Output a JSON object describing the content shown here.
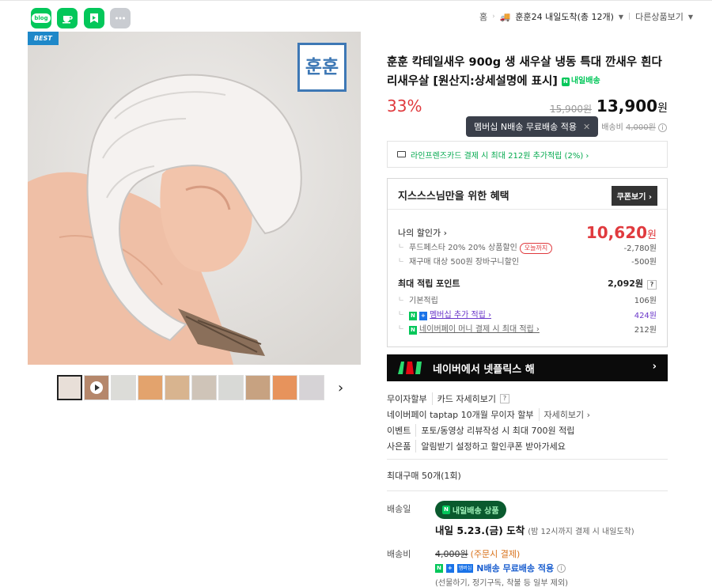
{
  "share": {
    "blog_label": "blog",
    "icons": [
      "blog-icon",
      "cafe-icon",
      "bookmark-icon",
      "more-icon"
    ]
  },
  "breadcrumb": {
    "home": "홈",
    "category": "훈훈24 내일도착(총 12개)",
    "other": "다른상품보기"
  },
  "gallery": {
    "badge": "BEST",
    "brand_logo": "훈훈",
    "thumb_count": 10
  },
  "product": {
    "title": "훈훈 칵테일새우 900g 생 새우살 냉동 특대 깐새우 흰다리새우살 [원산지:상세설명에 표시]",
    "next_day_label": "내일배송",
    "discount_rate": "33%",
    "original_price": "15,900원",
    "sale_price_num": "13,900",
    "sale_price_unit": "원"
  },
  "tooltip": {
    "text": "멤버십 N배송 무료배송 적용",
    "close": "✕"
  },
  "shipping_fee": {
    "label": "배송비",
    "amount": "4,000원"
  },
  "card_promo": {
    "text": "라인프렌즈카드 결제 시 최대 212원 추가적립 (2%) ›"
  },
  "benefit": {
    "title": "지스스스님만을 위한 혜택",
    "coupon_button": "쿠폰보기 ›",
    "my_price_label": "나의 할인가 ›",
    "my_price_num": "10,620",
    "my_price_unit": "원",
    "discounts": [
      {
        "label": "푸드페스타 20% 20% 상품할인",
        "tag": "오늘까지",
        "value": "-2,780원"
      },
      {
        "label": "재구매 대상 500원 장바구니할인",
        "value": "-500원"
      }
    ],
    "points_label": "최대 적립 포인트",
    "points_total": "2,092원",
    "points_help": "?",
    "points": [
      {
        "label": "기본적립",
        "value": "106원"
      },
      {
        "label": "멤버십 추가 적립 ›",
        "value": "424원"
      },
      {
        "label": "네이버페이 머니 결제 시 최대 적립 ›",
        "value": "212원"
      }
    ]
  },
  "netflix_banner": {
    "text": "네이버에서 넷플릭스 해",
    "arrow": "›"
  },
  "payment_info": [
    {
      "key": "무이자할부",
      "value": "카드 자세히보기",
      "link": "?"
    },
    {
      "key": "네이버페이 taptap 10개월 무이자 할부",
      "value": "",
      "link": "자세히보기 ›"
    },
    {
      "key": "이벤트",
      "value": "포토/동영상 리뷰작성 시 최대 700원 적립",
      "link": ""
    },
    {
      "key": "사은품",
      "value": "알림받기 설정하고 할인쿠폰 받아가세요",
      "link": ""
    }
  ],
  "max_purchase": "최대구매 50개(1회)",
  "delivery": {
    "label": "배송일",
    "badge": "내일배송 상품",
    "arrive_main": "내일 5.23.(금) 도착",
    "arrive_note": "(밤 12시까지 결제 시 내일도착)",
    "fee_label": "배송비",
    "fee_original": "4,000원",
    "fee_condition": "(주문시 결제)",
    "member_mark": "멤버십",
    "free_text": "N배송 무료배송 적용",
    "exclusions": "(선물하기, 정기구독, 착불 등 일부 제외)"
  }
}
